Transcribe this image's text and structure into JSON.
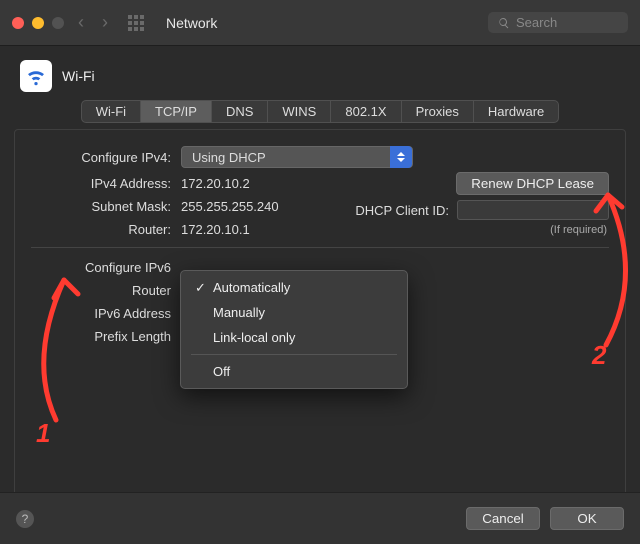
{
  "window": {
    "title": "Network",
    "search_placeholder": "Search"
  },
  "header": {
    "connection_name": "Wi-Fi"
  },
  "tabs": [
    "Wi-Fi",
    "TCP/IP",
    "DNS",
    "WINS",
    "802.1X",
    "Proxies",
    "Hardware"
  ],
  "active_tab": "TCP/IP",
  "ipv4": {
    "configure_label": "Configure IPv4:",
    "configure_value": "Using DHCP",
    "address_label": "IPv4 Address:",
    "address_value": "172.20.10.2",
    "subnet_label": "Subnet Mask:",
    "subnet_value": "255.255.255.240",
    "router_label": "Router:",
    "router_value": "172.20.10.1",
    "renew_button": "Renew DHCP Lease",
    "client_id_label": "DHCP Client ID:",
    "client_id_value": "",
    "client_id_hint": "(If required)"
  },
  "ipv6": {
    "configure_label": "Configure IPv6",
    "router_label": "Router",
    "address_label": "IPv6 Address",
    "prefix_label": "Prefix Length",
    "menu_items": [
      "Automatically",
      "Manually",
      "Link-local only",
      "Off"
    ],
    "menu_selected": "Automatically"
  },
  "footer": {
    "cancel": "Cancel",
    "ok": "OK"
  },
  "annotations": {
    "one": "1",
    "two": "2"
  }
}
